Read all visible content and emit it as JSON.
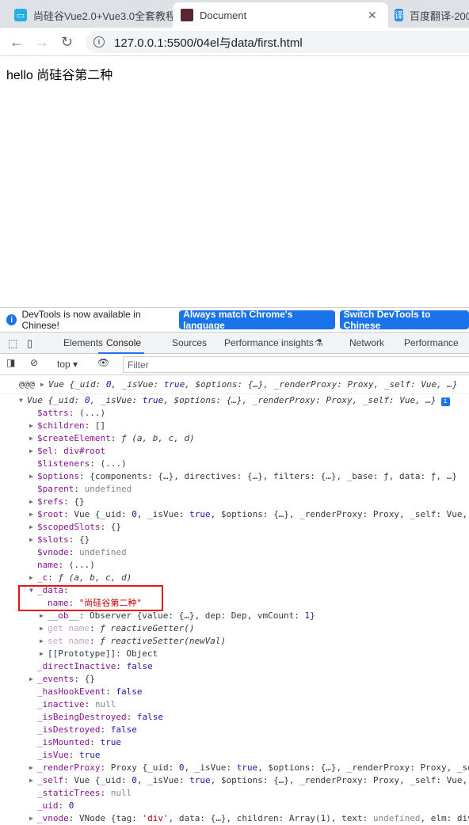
{
  "browser": {
    "tabs": [
      {
        "title": "尚硅谷Vue2.0+Vue3.0全套教程",
        "icon": "bilibili-icon"
      },
      {
        "title": "Document",
        "icon": "page-thumbnail-icon",
        "active": true
      },
      {
        "title": "百度翻译-200",
        "icon": "baidu-translate-icon",
        "glyph": "译"
      }
    ],
    "url": "127.0.0.1:5500/04el与data/first.html"
  },
  "page": {
    "text": "hello 尚硅谷第二种"
  },
  "devtools": {
    "infobar": {
      "message": "DevTools is now available in Chinese!",
      "btn1": "Always match Chrome's language",
      "btn2": "Switch DevTools to Chinese"
    },
    "tabs": [
      "Elements",
      "Console",
      "Sources",
      "Performance insights",
      "Network",
      "Performance"
    ],
    "active_tab": "Console",
    "context": "top",
    "filter_placeholder": "Filter",
    "accent": "#1a73e8"
  },
  "console": [
    {
      "ind": 0,
      "pre": "@@@ ",
      "arrow": "right",
      "seg": [
        [
          "Vue {_uid: ",
          "v it"
        ],
        [
          "0",
          "b it"
        ],
        [
          ", _isVue: ",
          "v it"
        ],
        [
          "true",
          "b it"
        ],
        [
          ", $options: {…}, _renderProxy: Proxy, _self: Vue, …}",
          "v it"
        ]
      ],
      "sep": true
    },
    {
      "ind": 0,
      "arrow": "down",
      "seg": [
        [
          "Vue {_uid: ",
          "v it"
        ],
        [
          "0",
          "b it"
        ],
        [
          ", _isVue: ",
          "v it"
        ],
        [
          "true",
          "b it"
        ],
        [
          ", $options: {…}, _renderProxy: Proxy, _self: Vue, …}",
          "v it"
        ]
      ],
      "badge": "i"
    },
    {
      "ind": 1,
      "key": "$attrs",
      "seg": [
        [
          "(...)",
          "v"
        ]
      ]
    },
    {
      "ind": 1,
      "arrow": "right",
      "key": "$children",
      "seg": [
        [
          "[]",
          "v"
        ]
      ]
    },
    {
      "ind": 1,
      "arrow": "right",
      "key": "$createElement",
      "seg": [
        [
          "ƒ (a, b, c, d)",
          "v it"
        ]
      ]
    },
    {
      "ind": 1,
      "arrow": "right",
      "key": "$el",
      "seg": [
        [
          "div#root",
          "k"
        ]
      ]
    },
    {
      "ind": 1,
      "key": "$listeners",
      "seg": [
        [
          "(...)",
          "v"
        ]
      ]
    },
    {
      "ind": 1,
      "arrow": "right",
      "key": "$options",
      "seg": [
        [
          "{components: {…}, directives: {…}, filters: {…}, _base: ƒ, data: ƒ, …}",
          "v"
        ]
      ]
    },
    {
      "ind": 1,
      "key": "$parent",
      "seg": [
        [
          "undefined",
          "u"
        ]
      ]
    },
    {
      "ind": 1,
      "arrow": "right",
      "key": "$refs",
      "seg": [
        [
          "{}",
          "v"
        ]
      ]
    },
    {
      "ind": 1,
      "arrow": "right",
      "key": "$root",
      "seg": [
        [
          "Vue {_uid: ",
          "v"
        ],
        [
          "0",
          "b"
        ],
        [
          ", _isVue: ",
          "v"
        ],
        [
          "true",
          "b"
        ],
        [
          ", $options: {…}, _renderProxy: Proxy, _self: Vue,",
          "v"
        ]
      ]
    },
    {
      "ind": 1,
      "arrow": "right",
      "key": "$scopedSlots",
      "seg": [
        [
          "{}",
          "v"
        ]
      ]
    },
    {
      "ind": 1,
      "arrow": "right",
      "key": "$slots",
      "seg": [
        [
          "{}",
          "v"
        ]
      ]
    },
    {
      "ind": 1,
      "key": "$vnode",
      "seg": [
        [
          "undefined",
          "u"
        ]
      ]
    },
    {
      "ind": 1,
      "key": "name",
      "seg": [
        [
          "(...)",
          "v"
        ]
      ]
    },
    {
      "ind": 1,
      "arrow": "right",
      "key": "_c",
      "seg": [
        [
          "ƒ (a, b, c, d)",
          "v it"
        ]
      ]
    },
    {
      "ind": 1,
      "arrow": "down",
      "key": "_data",
      "seg": []
    },
    {
      "ind": 2,
      "key": "name",
      "seg": [
        [
          "\"尚硅谷第二种\"",
          "s"
        ]
      ]
    },
    {
      "ind": 2,
      "arrow": "right",
      "key": "__ob__",
      "seg": [
        [
          "Observer {value: {…}, dep: Dep, vmCount: ",
          "v"
        ],
        [
          "1",
          "b"
        ],
        [
          "}",
          "v"
        ]
      ]
    },
    {
      "ind": 2,
      "arrow": "right",
      "key": "get name",
      "dim": true,
      "seg": [
        [
          "ƒ reactiveGetter()",
          "v it"
        ]
      ]
    },
    {
      "ind": 2,
      "arrow": "right",
      "key": "[[Prototype]]",
      "plain": true,
      "seg": [
        [
          "Object",
          "v"
        ]
      ]
    },
    {
      "ind": 1,
      "key": "_directInactive",
      "seg": [
        [
          "false",
          "b"
        ]
      ]
    },
    {
      "ind": 1,
      "arrow": "right",
      "key": "_events",
      "seg": [
        [
          "{}",
          "v"
        ]
      ]
    },
    {
      "ind": 1,
      "key": "_hasHookEvent",
      "seg": [
        [
          "false",
          "b"
        ]
      ]
    },
    {
      "ind": 1,
      "key": "_inactive",
      "seg": [
        [
          "null",
          "u"
        ]
      ]
    },
    {
      "ind": 1,
      "key": "_isBeingDestroyed",
      "seg": [
        [
          "false",
          "b"
        ]
      ]
    },
    {
      "ind": 1,
      "key": "_isDestroyed",
      "seg": [
        [
          "false",
          "b"
        ]
      ]
    },
    {
      "ind": 1,
      "key": "_isMounted",
      "seg": [
        [
          "true",
          "b"
        ]
      ]
    },
    {
      "ind": 1,
      "key": "_isVue",
      "seg": [
        [
          "true",
          "b"
        ]
      ]
    },
    {
      "ind": 1,
      "arrow": "right",
      "key": "_renderProxy",
      "seg": [
        [
          "Proxy {_uid: ",
          "v"
        ],
        [
          "0",
          "b"
        ],
        [
          ", _isVue: ",
          "v"
        ],
        [
          "true",
          "b"
        ],
        [
          ", $options: {…}, _renderProxy: Proxy, _se",
          "v"
        ]
      ]
    },
    {
      "ind": 1,
      "arrow": "right",
      "key": "_self",
      "seg": [
        [
          "Vue {_uid: ",
          "v"
        ],
        [
          "0",
          "b"
        ],
        [
          ", _isVue: ",
          "v"
        ],
        [
          "true",
          "b"
        ],
        [
          ", $options: {…}, _renderProxy: Proxy, _self: Vue,",
          "v"
        ]
      ]
    },
    {
      "ind": 1,
      "key": "_staticTrees",
      "seg": [
        [
          "null",
          "u"
        ]
      ]
    },
    {
      "ind": 1,
      "key": "_uid",
      "seg": [
        [
          "0",
          "b"
        ]
      ]
    },
    {
      "ind": 1,
      "arrow": "right",
      "key": "_vnode",
      "seg": [
        [
          "VNode {tag: ",
          "v"
        ],
        [
          "'div'",
          "s"
        ],
        [
          ", data: {…}, children: Array(1), text: ",
          "v"
        ],
        [
          "undefined",
          "u"
        ],
        [
          ", elm: div",
          "v"
        ]
      ]
    }
  ]
}
